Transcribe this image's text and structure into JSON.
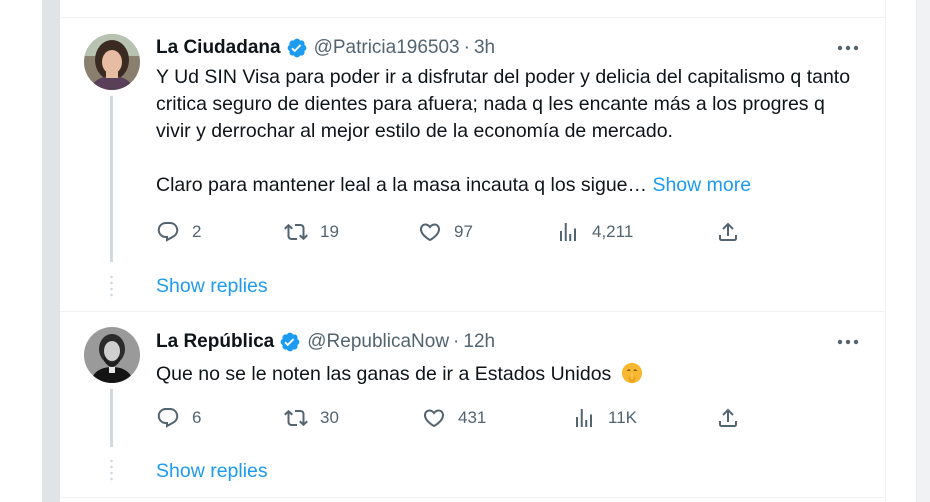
{
  "tweets": [
    {
      "author_name": "La Ciudadana",
      "handle": "@Patricia196503",
      "separator": "·",
      "time": "3h",
      "body_lines": [
        "Y Ud SIN Visa para poder ir a disfrutar del poder y delicia del capitalismo q tanto critica seguro de dientes para afuera; nada q les encante más a los progres q vivir y derrochar al mejor estilo de la economía de mercado.",
        "Claro para mantener leal a la masa incauta q los sigue…"
      ],
      "show_more": "Show more",
      "replies": "2",
      "reposts": "19",
      "likes": "97",
      "views": "4,211",
      "show_replies": "Show replies"
    },
    {
      "author_name": "La República",
      "handle": "@RepublicaNow",
      "separator": "·",
      "time": "12h",
      "body": "Que no se le noten las ganas de ir a Estados Unidos",
      "emoji": "shushing-face-emoji",
      "replies": "6",
      "reposts": "30",
      "likes": "431",
      "views": "11K",
      "show_replies": "Show replies"
    }
  ],
  "colors": {
    "link": "#1d9bf0",
    "secondary_text": "#536471",
    "verified": "#1d9bf0",
    "thread_line": "#cfd9de"
  },
  "icons": {
    "reply": "reply-icon",
    "repost": "repost-icon",
    "like": "heart-icon",
    "views": "views-icon",
    "share": "share-icon",
    "more": "more-icon",
    "verified": "verified-badge-icon"
  }
}
